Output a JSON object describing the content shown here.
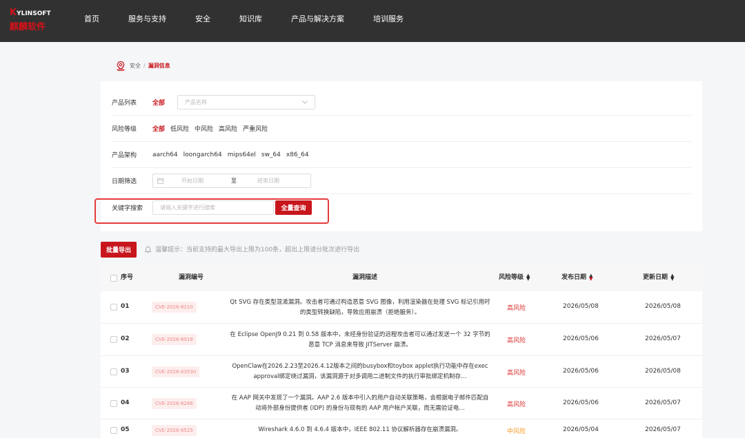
{
  "brand": {
    "logo_en_k": "K",
    "logo_en_rest": "YLINSOFT",
    "logo_cn": "麒麟软件"
  },
  "nav": [
    "首页",
    "服务与支持",
    "安全",
    "知识库",
    "产品与解决方案",
    "培训服务"
  ],
  "breadcrumb": {
    "parent": "安全",
    "separator": "/",
    "current": "漏洞信息"
  },
  "filters": {
    "product": {
      "label": "产品列表",
      "all": "全部",
      "placeholder": "产品名称"
    },
    "risk": {
      "label": "风险等级",
      "options": [
        "全部",
        "低风险",
        "中风险",
        "高风险",
        "严重风险"
      ]
    },
    "arch": {
      "label": "产品架构",
      "options": [
        "aarch64",
        "loongarch64",
        "mips64el",
        "sw_64",
        "x86_64"
      ]
    },
    "date": {
      "label": "日期筛选",
      "start_placeholder": "开始日期",
      "to": "至",
      "end_placeholder": "结束日期"
    },
    "keyword": {
      "label": "关键字搜索",
      "placeholder": "请输入关键字进行搜索",
      "button": "全量查询"
    }
  },
  "export": {
    "button": "批量导出",
    "tip": "温馨提示：当前支持的最大导出上限为100条，超出上限请分批次进行导出"
  },
  "table": {
    "headers": {
      "index": "序号",
      "cve": "漏洞编号",
      "desc": "漏洞描述",
      "risk": "风险等级",
      "published": "发布日期",
      "updated": "更新日期"
    },
    "rows": [
      {
        "index": "01",
        "cve": "CVE-2026-6210",
        "desc": "Qt SVG 存在类型混淆漏洞。攻击者可通过构造恶意 SVG 图像，利用渲染器在处理 SVG 标记引用时的类型转换缺陷，导致应用崩溃（拒绝服务）。",
        "risk": "高风险",
        "published": "2026/05/08",
        "updated": "2026/05/08"
      },
      {
        "index": "02",
        "cve": "CVE-2026-6918",
        "desc": "在 Eclipse OpenJ9 0.21 到 0.58 版本中，未经身份验证的远程攻击者可以通过发送一个 32 字节的恶意 TCP 消息来导致 JITServer 崩溃。",
        "risk": "高风险",
        "published": "2026/05/06",
        "updated": "2026/05/07"
      },
      {
        "index": "03",
        "cve": "CVE-2026-43530",
        "desc": "OpenClaw在2026.2.23至2026.4.12版本之间的busybox和toybox applet执行功能中存在exec approval绑定绕过漏洞，该漏洞源于对多调用二进制文件的执行审批绑定机制存…",
        "risk": "高风险",
        "published": "2026/05/06",
        "updated": "2026/05/08"
      },
      {
        "index": "04",
        "cve": "CVE-2026-6266",
        "desc": "在 AAP 网关中发现了一个漏洞。AAP 2.6 版本中引入的用户自动关联策略，会根据电子邮件匹配自动将外部身份提供者 (IDP) 的身份与现有的 AAP 用户帐户关联，而无需验证电…",
        "risk": "高风险",
        "published": "2026/05/06",
        "updated": "2026/05/07"
      },
      {
        "index": "05",
        "cve": "CVE-2026-6525",
        "desc": "Wireshark 4.6.0 到 4.6.4 版本中，IEEE 802.11 协议解析器存在崩溃漏洞。",
        "risk": "中风险",
        "published": "2026/05/04",
        "updated": "2026/05/07"
      }
    ]
  },
  "colors": {
    "accent": "#c8161d",
    "header_bg": "#313131",
    "risk_high": "#d9302c",
    "risk_mid": "#f59a23"
  }
}
